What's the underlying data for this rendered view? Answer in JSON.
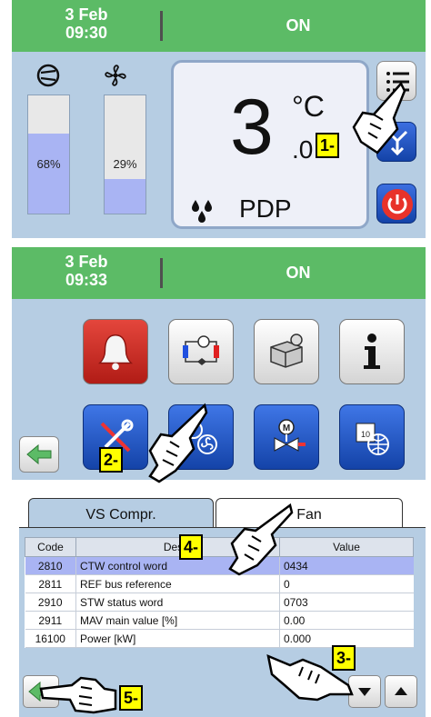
{
  "panel_home": {
    "status": {
      "date": "3 Feb",
      "time": "09:30",
      "state": "ON"
    },
    "compressor_bar": {
      "icon": "compressor-icon",
      "value_label": "68%",
      "fill": 0.68
    },
    "fan_bar": {
      "icon": "fan-icon",
      "value_label": "29%",
      "fill": 0.29
    },
    "temperature": {
      "integer": "3",
      "unit": "°C",
      "decimal": ".0"
    },
    "measure_label": "PDP",
    "buttons": {
      "menu": "list-icon",
      "valve": "valve-icon",
      "power": "power-icon"
    }
  },
  "panel_menu": {
    "status": {
      "date": "3 Feb",
      "time": "09:33",
      "state": "ON"
    },
    "tiles": [
      {
        "icon": "bell-icon"
      },
      {
        "icon": "refrigeration-circuit-icon"
      },
      {
        "icon": "machine-settings-icon"
      },
      {
        "icon": "info-icon"
      },
      {
        "icon": "tools-icon"
      },
      {
        "icon": "compressor-fan-settings-icon"
      },
      {
        "icon": "motor-valve-icon"
      },
      {
        "icon": "calendar-network-icon"
      }
    ],
    "back_icon": "arrow-left-icon"
  },
  "panel_params": {
    "tabs": [
      {
        "label": "VS Compr."
      },
      {
        "label": "Fan"
      }
    ],
    "columns": {
      "code": "Code",
      "desc": "Descr",
      "value": "Value"
    },
    "rows": [
      {
        "code": "2810",
        "desc": "CTW control word",
        "value": "0434"
      },
      {
        "code": "2811",
        "desc": "REF bus reference",
        "value": "0"
      },
      {
        "code": "2910",
        "desc": "STW status word",
        "value": "0703"
      },
      {
        "code": "2911",
        "desc": "MAV main value [%]",
        "value": "0.00"
      },
      {
        "code": "16100",
        "desc": "Power [kW]",
        "value": "0.000"
      }
    ],
    "nav_icons": {
      "back": "arrow-left-icon",
      "down": "arrow-down-icon",
      "up": "arrow-up-icon"
    }
  },
  "callouts": {
    "step1": "1-",
    "step2": "2-",
    "step3": "3-",
    "step4": "4-",
    "step5": "5-"
  },
  "colors": {
    "status_green": "#5cbb66",
    "panel_blue": "#b6cde3",
    "selection": "#a9b4f3",
    "highlight_yellow": "#ffff00"
  }
}
